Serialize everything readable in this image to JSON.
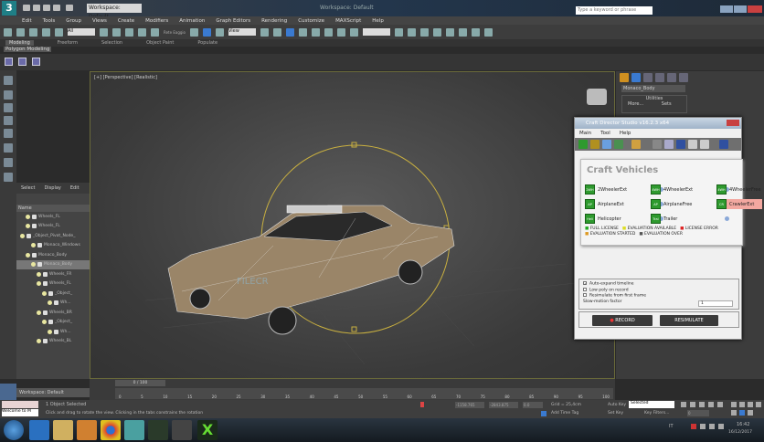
{
  "app": {
    "workspace": "Workspace: Default",
    "window_title": "Workspace: Default",
    "search_placeholder": "Type a keyword or phrase"
  },
  "menu": [
    "Edit",
    "Tools",
    "Group",
    "Views",
    "Create",
    "Modifiers",
    "Animation",
    "Graph Editors",
    "Rendering",
    "Customize",
    "MAXScript",
    "Help"
  ],
  "toolbar": {
    "selection_filter": "All",
    "view": "View",
    "rotate_label": "Rete Eaggio"
  },
  "ribbon": {
    "tabs": [
      "Modeling",
      "Freeform",
      "Selection",
      "Object Paint",
      "Populate"
    ],
    "active": "Modeling",
    "panel": "Polygon Modeling"
  },
  "explorer": {
    "tabs": [
      "Select",
      "Display",
      "Edit"
    ],
    "column": "Name",
    "nodes": [
      {
        "label": "Wheels_FL",
        "depth": 1
      },
      {
        "label": "Wheels_FL",
        "depth": 1
      },
      {
        "label": "_Object_Pivot_Node_",
        "depth": 0
      },
      {
        "label": "Monaco_Windows",
        "depth": 2
      },
      {
        "label": "Monaco_Body",
        "depth": 1
      },
      {
        "label": "Monaco_Body",
        "depth": 2,
        "selected": true
      },
      {
        "label": "Wheels_FR",
        "depth": 3
      },
      {
        "label": "Wheels_FL",
        "depth": 3
      },
      {
        "label": "_Object_",
        "depth": 4
      },
      {
        "label": "Wh...",
        "depth": 5
      },
      {
        "label": "Wheels_BR",
        "depth": 3
      },
      {
        "label": "_Object_",
        "depth": 4
      },
      {
        "label": "Wh...",
        "depth": 5
      },
      {
        "label": "Wheels_BL",
        "depth": 3
      }
    ]
  },
  "viewport": {
    "label": "[+] [Perspective] [Realistic]",
    "watermark": "FILECR"
  },
  "command_panel": {
    "object_name": "Monaco_Body",
    "rollout": "Utilities",
    "more": "More...",
    "sets": "Sets"
  },
  "craft": {
    "title": "Craft Director Studio v16.2.3 x64",
    "menu": [
      "Main",
      "Tool",
      "Help"
    ],
    "heading": "Craft Vehicles",
    "vehicles": [
      {
        "badge": "2WH",
        "label": "2WheelerExt"
      },
      {
        "badge": "4WH",
        "label": "4WheelerExt"
      },
      {
        "badge": "4WH",
        "label": "4WheelerFree"
      },
      {
        "badge": "AP",
        "label": "AirplaneExt"
      },
      {
        "badge": "AP",
        "label": "AirplaneFree"
      },
      {
        "badge": "CR",
        "label": "CrawlerExt",
        "highlighted": true
      },
      {
        "badge": "Heli",
        "label": "Helicopter"
      },
      {
        "badge": "Trai",
        "label": "Trailer"
      }
    ],
    "legend": [
      {
        "label": "FULL LICENSE",
        "color": "#22aa22"
      },
      {
        "label": "EVALUATION AVAILABLE",
        "color": "#dddd22"
      },
      {
        "label": "LICENSE ERROR",
        "color": "#dd2222"
      },
      {
        "label": "EVALUATION STARTED",
        "color": "#dd9922"
      },
      {
        "label": "EVALUATION OVER",
        "color": "#555555"
      }
    ],
    "options": [
      {
        "label": "Auto-expand timeline",
        "checked": true
      },
      {
        "label": "Low poly on record",
        "checked": false
      },
      {
        "label": "Resimulate from first frame",
        "checked": false
      }
    ],
    "slow_motion_label": "Slow-motion factor",
    "slow_motion_value": "1",
    "record": "RECORD",
    "resimulate": "RESIMULATE"
  },
  "timeline": {
    "frame": "0 / 100",
    "ticks": [
      "0",
      "5",
      "10",
      "15",
      "20",
      "25",
      "30",
      "35",
      "40",
      "45",
      "50",
      "55",
      "60",
      "65",
      "70",
      "75",
      "80",
      "85",
      "90",
      "95",
      "100"
    ]
  },
  "status": {
    "selected": "1 Object Selected",
    "prompt": "Click and drag to rotate the view.  Clicking in the tabs constrains the rotation",
    "welcome": "Welcome to M",
    "x": "-1158.765",
    "y": "-2843.875",
    "z": "0.0",
    "grid": "Grid = 25,4cm",
    "add_time_tag": "Add Time Tag",
    "auto_key": "Auto Key",
    "set_key": "Set Key",
    "key_mode": "Selected",
    "key_filters": "Key Filters...",
    "frame_value": "0"
  },
  "taskbar": {
    "time": "16:42",
    "date": "16/12/2017",
    "lang": "IT"
  }
}
